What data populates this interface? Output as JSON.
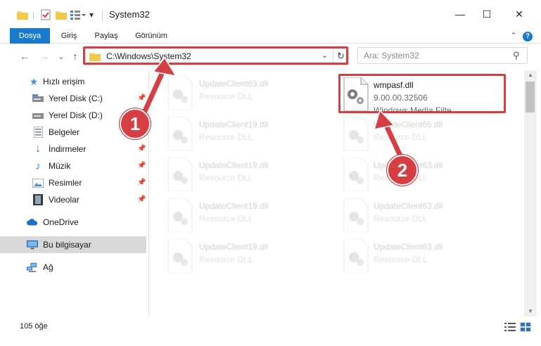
{
  "window": {
    "title": "System32",
    "minimize": "—",
    "maximize": "☐",
    "close": "✕"
  },
  "ribbon": {
    "tabs": [
      "Dosya",
      "Giriş",
      "Paylaş",
      "Görünüm"
    ],
    "collapse": "⌃",
    "help": "?"
  },
  "navigation": {
    "back": "←",
    "forward": "→",
    "recent": "⌄",
    "up": "↑",
    "address_path": "C:\\Windows\\System32",
    "dropdown": "⌄",
    "refresh": "↻",
    "search_placeholder": "Ara: System32",
    "search_icon": "⚲"
  },
  "sidebar": {
    "items": [
      {
        "label": "Hızlı erişim",
        "icon": "star-icon",
        "pinned": false
      },
      {
        "label": "Yerel Disk (C:)",
        "icon": "drive-icon",
        "pinned": true
      },
      {
        "label": "Yerel Disk (D:)",
        "icon": "drive-icon",
        "pinned": true
      },
      {
        "label": "Belgeler",
        "icon": "documents-icon",
        "pinned": true
      },
      {
        "label": "İndirmeler",
        "icon": "download-icon",
        "pinned": true
      },
      {
        "label": "Müzik",
        "icon": "music-icon",
        "pinned": true
      },
      {
        "label": "Resimler",
        "icon": "pictures-icon",
        "pinned": true
      },
      {
        "label": "Videolar",
        "icon": "videos-icon",
        "pinned": true
      },
      {
        "label": "OneDrive",
        "icon": "cloud-icon",
        "pinned": false
      },
      {
        "label": "Bu bilgisayar",
        "icon": "computer-icon",
        "pinned": false,
        "selected": true
      },
      {
        "label": "Ağ",
        "icon": "network-icon",
        "pinned": false
      }
    ],
    "pin_glyph": "📌"
  },
  "files": {
    "highlighted": {
      "name": "wmpasf.dll",
      "version": "9.00.00.32506",
      "description": "Windows Media Filte..."
    },
    "left_column": [
      {
        "name": "UpdateClient63.dll",
        "type": "Resource DLL"
      },
      {
        "name": "UpdateClient19.dll",
        "type": "Resource DLL"
      },
      {
        "name": "UpdateClient19.dll",
        "type": "Resource DLL"
      },
      {
        "name": "UpdateClient19.dll",
        "type": "Resource DLL"
      },
      {
        "name": "UpdateClient19.dll",
        "type": "Resource DLL"
      }
    ],
    "right_column": [
      {
        "name": "UpdateClient65.dll",
        "type": "Resource DLL"
      },
      {
        "name": "UpdateClient63.dll",
        "type": "Resource DLL"
      },
      {
        "name": "UpdateClient63.dll",
        "type": "Resource DLL"
      },
      {
        "name": "UpdateClient63.dll",
        "type": "Resource DLL"
      }
    ]
  },
  "status": {
    "item_count": "105 öğe"
  },
  "annotations": {
    "step1": "1",
    "step2": "2",
    "highlight_color": "#d53e43"
  },
  "colors": {
    "accent": "#1979ca",
    "folder": "#f8d775",
    "annotation": "#d53e43"
  }
}
